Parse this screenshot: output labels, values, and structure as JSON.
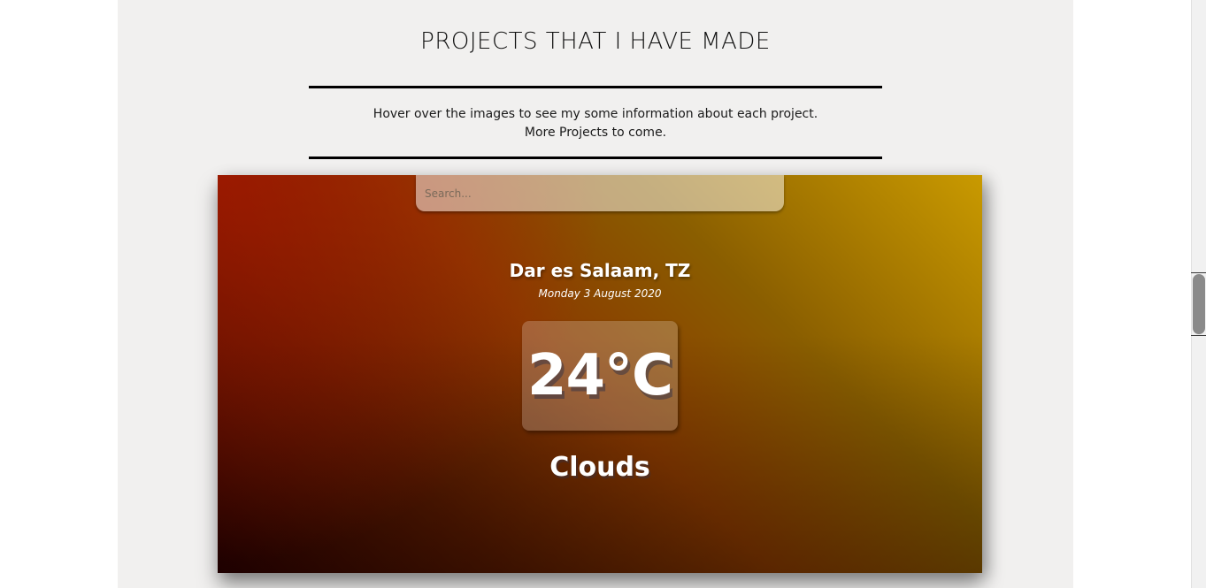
{
  "section": {
    "title": "PROJECTS THAT I HAVE MADE",
    "description_line1": "Hover over the images to see my some information about each project.",
    "description_line2": "More Projects to come."
  },
  "weather_app": {
    "search_placeholder": "Search...",
    "location": "Dar es Salaam, TZ",
    "date": "Monday 3 August 2020",
    "temperature": "24°C",
    "condition": "Clouds",
    "colors": {
      "gradient_start": "#2e0000",
      "gradient_mid": "#8a3a00",
      "gradient_end": "#c99a00",
      "accent_red": "#aa1400"
    }
  }
}
